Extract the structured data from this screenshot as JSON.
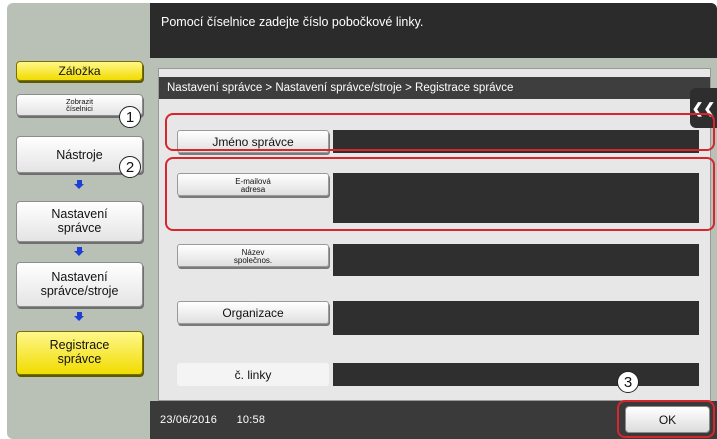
{
  "topbar": {
    "message": "Pomocí číselnice zadejte číslo pobočkové linky."
  },
  "sidebar": {
    "bookmark_label": "Záložka",
    "keypad_label_line1": "Zobrazit",
    "keypad_label_line2": "číselnici",
    "steps": [
      {
        "line1": "Nástroje",
        "line2": ""
      },
      {
        "line1": "Nastavení",
        "line2": "správce"
      },
      {
        "line1": "Nastavení",
        "line2": "správce/stroje"
      },
      {
        "line1": "Registrace",
        "line2": "správce"
      }
    ]
  },
  "breadcrumb": "Nastavení správce > Nastavení správce/stroje > Registrace správce",
  "fields": [
    {
      "line1": "Jméno správce",
      "line2": "",
      "value": ""
    },
    {
      "line1": "E-mailová",
      "line2": "adresa",
      "value": ""
    },
    {
      "line1": "Název",
      "line2": "společnos.",
      "value": ""
    },
    {
      "line1": "Organizace",
      "line2": "",
      "value": ""
    },
    {
      "line1": "č. linky",
      "line2": "",
      "value": ""
    }
  ],
  "status": {
    "date": "23/06/2016",
    "time": "10:58"
  },
  "ok_label": "OK",
  "callouts": [
    "1",
    "2",
    "3"
  ],
  "scroll_tab_icon": "double-chevron-left-icon",
  "colors": {
    "highlight": "#f1dc00",
    "annotation": "#d8262e",
    "arrow": "#1d3fd6"
  }
}
